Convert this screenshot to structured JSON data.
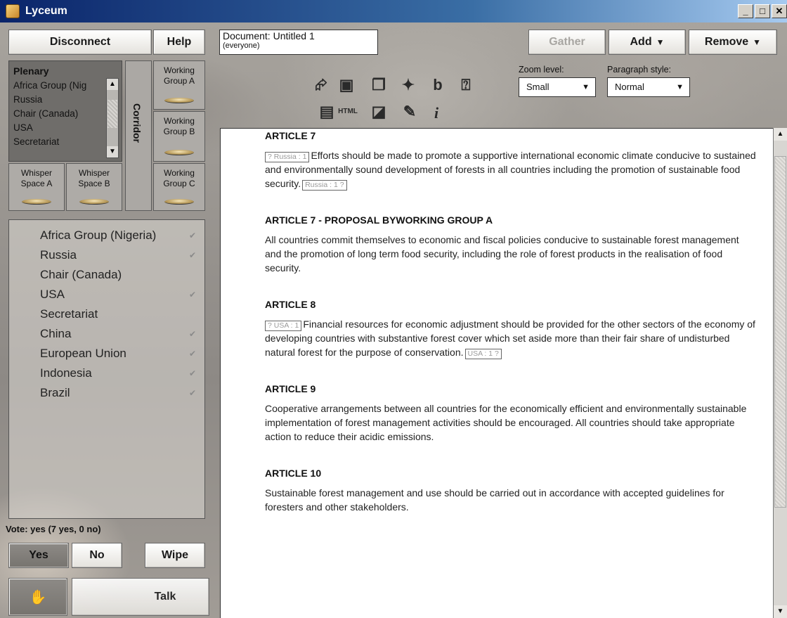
{
  "window": {
    "title": "Lyceum"
  },
  "toolbar": {
    "disconnect": "Disconnect",
    "help": "Help",
    "gather": "Gather",
    "add": "Add",
    "remove": "Remove",
    "zoom_label": "Zoom level:",
    "zoom_value": "Small",
    "paragraph_label": "Paragraph style:",
    "paragraph_value": "Normal"
  },
  "document": {
    "title": "Document: Untitled 1",
    "audience": "(everyone)"
  },
  "rooms": {
    "plenary": {
      "title": "Plenary",
      "members": [
        "Africa Group (Nig",
        "Russia",
        "Chair (Canada)",
        "USA",
        "Secretariat"
      ]
    },
    "corridor": "Corridor",
    "working_a": [
      "Working",
      "Group A"
    ],
    "working_b": [
      "Working",
      "Group B"
    ],
    "working_c": [
      "Working",
      "Group C"
    ],
    "whisper_a": [
      "Whisper",
      "Space A"
    ],
    "whisper_b": [
      "Whisper",
      "Space B"
    ]
  },
  "participants": [
    {
      "name": "Africa Group (Nigeria)",
      "voted": true
    },
    {
      "name": "Russia",
      "voted": true
    },
    {
      "name": "Chair (Canada)",
      "voted": false
    },
    {
      "name": "USA",
      "voted": true
    },
    {
      "name": "Secretariat",
      "voted": false
    },
    {
      "name": "China",
      "voted": true
    },
    {
      "name": "European Union",
      "voted": true
    },
    {
      "name": "Indonesia",
      "voted": true
    },
    {
      "name": "Brazil",
      "voted": true
    }
  ],
  "vote": {
    "status": "Vote: yes (7 yes, 0 no)",
    "yes": "Yes",
    "no": "No",
    "wipe": "Wipe",
    "talk": "Talk"
  },
  "icons": [
    "open-icon",
    "delete-icon",
    "copy-icon",
    "sparkle-icon",
    "bold-icon",
    "help-icon",
    "save-icon",
    "html-icon",
    "edit-icon",
    "highlight-icon",
    "info-icon"
  ],
  "articles": [
    {
      "heading": "ARTICLE 7",
      "tag_start": "? Russia : 1",
      "body": "Efforts should be made to promote a supportive international economic climate conducive to sustained and environmentally sound development of forests in all countries including the promotion of sustainable food security.",
      "tag_end": "Russia : 1 ?"
    },
    {
      "heading": "ARTICLE 7 - PROPOSAL BYWORKING GROUP A",
      "tag_start": "",
      "body": "All countries commit themselves to economic and fiscal policies conducive to sustainable forest management and the promotion of long term food security, including the role of forest products in the realisation of food security.",
      "tag_end": ""
    },
    {
      "heading": "ARTICLE 8",
      "tag_start": "? USA : 1",
      "body": "Financial resources for economic adjustment should be provided for the other sectors of the economy of developing countries with substantive forest cover which set aside more than their fair share of undisturbed natural forest for the purpose of conservation.",
      "tag_end": "USA : 1 ?"
    },
    {
      "heading": "ARTICLE 9",
      "tag_start": "",
      "body": "Cooperative arrangements between all countries for the economically efficient and environmentally sustainable implementation of forest management activities should be encouraged. All countries should take appropriate action to reduce their acidic emissions.",
      "tag_end": ""
    },
    {
      "heading": "ARTICLE 10",
      "tag_start": "",
      "body": "Sustainable forest management and use should be carried out in accordance with accepted guidelines for foresters and other stakeholders.",
      "tag_end": ""
    }
  ]
}
